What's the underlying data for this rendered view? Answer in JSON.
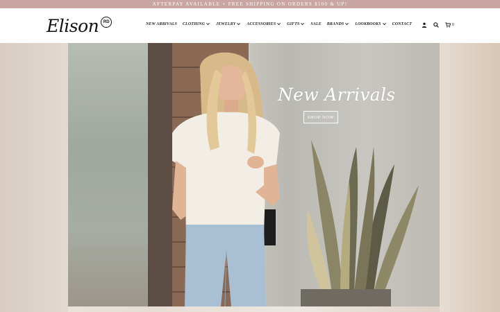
{
  "announcement": "AFTERPAY AVAILABLE + FREE SHIPPING ON ORDERS $100 & UP!",
  "logo": {
    "text": "Elison",
    "badge": "RD"
  },
  "nav": {
    "items": [
      {
        "label": "NEW ARRIVALS",
        "dropdown": false
      },
      {
        "label": "CLOTHING",
        "dropdown": true
      },
      {
        "label": "JEWELRY",
        "dropdown": true
      },
      {
        "label": "ACCESSORIES",
        "dropdown": true
      },
      {
        "label": "GIFTS",
        "dropdown": true
      },
      {
        "label": "SALE",
        "dropdown": false
      },
      {
        "label": "BRANDS",
        "dropdown": true
      },
      {
        "label": "LOOKBOOKS",
        "dropdown": true
      },
      {
        "label": "CONTACT",
        "dropdown": false
      }
    ]
  },
  "tools": {
    "account_icon": "user-icon",
    "search_icon": "search-icon",
    "cart_icon": "cart-icon",
    "cart_count": "0"
  },
  "hero": {
    "title": "New Arrivals",
    "button": "SHOP NOW"
  },
  "colors": {
    "announcement_bg": "#c9a6a1",
    "text": "#222222",
    "hero_text": "#ffffff"
  }
}
